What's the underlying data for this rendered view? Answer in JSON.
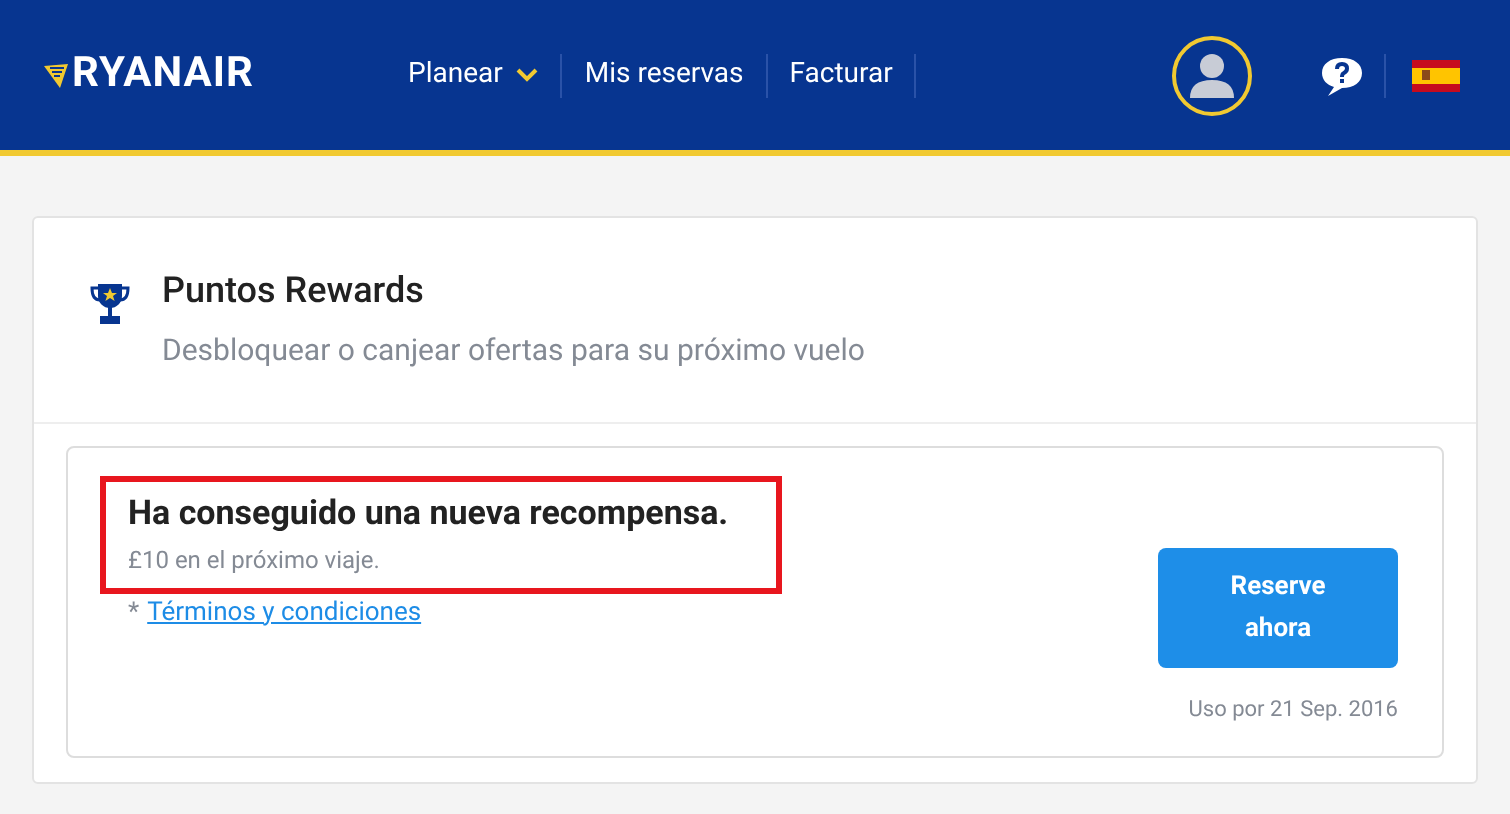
{
  "header": {
    "logo": "RYANAIR",
    "nav": [
      {
        "label": "Planear",
        "dropdown": true
      },
      {
        "label": "Mis reservas",
        "dropdown": false
      },
      {
        "label": "Facturar",
        "dropdown": false
      }
    ]
  },
  "rewards": {
    "title": "Puntos Rewards",
    "subtitle": "Desbloquear o canjear ofertas para su próximo vuelo"
  },
  "reward": {
    "title": "Ha conseguido una nueva recompensa.",
    "detail": "£10 en el próximo viaje.",
    "highlighted": true,
    "terms_prefix": "*",
    "terms_link": "Términos y condiciones",
    "button": "Reserve ahora",
    "expiry": "Uso por 21 Sep. 2016"
  }
}
